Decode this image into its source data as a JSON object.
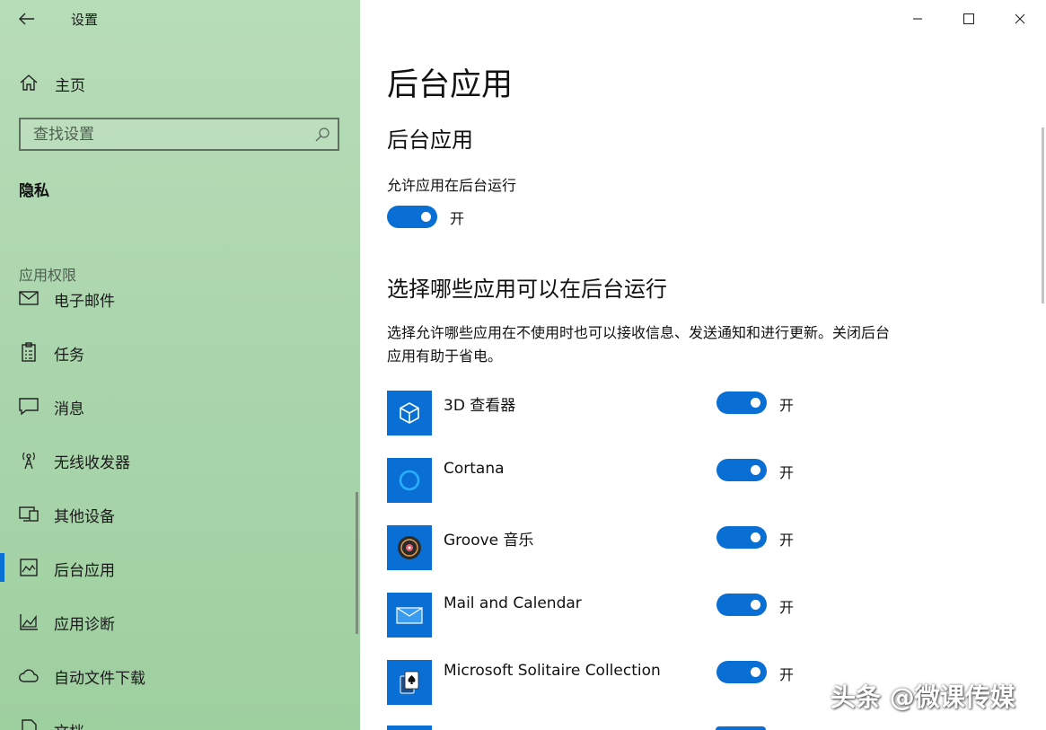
{
  "window": {
    "title": "设置"
  },
  "sidebar": {
    "home_label": "主页",
    "search_placeholder": "查找设置",
    "section_title": "隐私",
    "group_title": "应用权限",
    "items": [
      {
        "label": "电子邮件",
        "icon": "mail-icon"
      },
      {
        "label": "任务",
        "icon": "clipboard-icon"
      },
      {
        "label": "消息",
        "icon": "message-icon"
      },
      {
        "label": "无线收发器",
        "icon": "radio-antenna-icon"
      },
      {
        "label": "其他设备",
        "icon": "devices-icon"
      },
      {
        "label": "后台应用",
        "icon": "background-apps-icon",
        "active": true
      },
      {
        "label": "应用诊断",
        "icon": "diagnostics-icon"
      },
      {
        "label": "自动文件下载",
        "icon": "cloud-icon"
      },
      {
        "label": "文档",
        "icon": "document-icon"
      }
    ]
  },
  "main": {
    "page_title": "后台应用",
    "section1_title": "后台应用",
    "allow_label": "允许应用在后台运行",
    "allow_state": "开",
    "section2_title": "选择哪些应用可以在后台运行",
    "description": "选择允许哪些应用在不使用时也可以接收信息、发送通知和进行更新。关闭后台应用有助于省电。",
    "apps": [
      {
        "name": "3D 查看器",
        "state": "开",
        "icon": "cube-icon"
      },
      {
        "name": "Cortana",
        "state": "开",
        "icon": "cortana-ring-icon"
      },
      {
        "name": "Groove 音乐",
        "state": "开",
        "icon": "music-disc-icon"
      },
      {
        "name": "Mail and Calendar",
        "state": "开",
        "icon": "envelope-icon"
      },
      {
        "name": "Microsoft Solitaire Collection",
        "state": "开",
        "icon": "playing-card-icon"
      }
    ]
  },
  "watermark": "头条 @微课传媒",
  "colors": {
    "accent": "#0a6fd4",
    "sidebar_bg": "#a8d4aa"
  }
}
